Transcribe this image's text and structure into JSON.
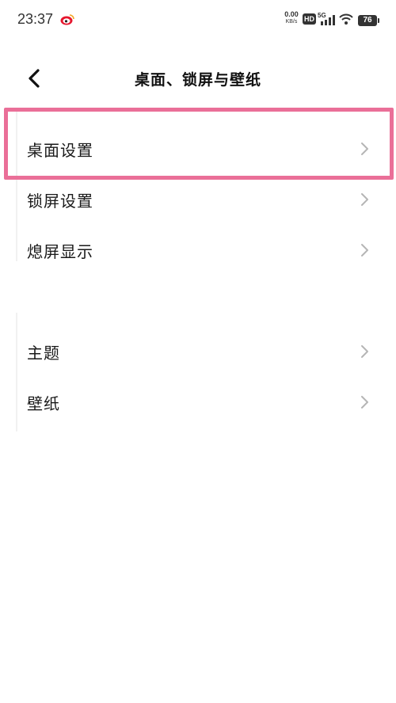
{
  "status_bar": {
    "time": "23:37",
    "net_speed_value": "0.00",
    "net_speed_unit": "KB/s",
    "hd_badge": "HD",
    "network_type": "5G",
    "battery_level": "76",
    "icons": [
      "weibo-icon",
      "signal-icon",
      "wifi-icon",
      "battery-icon"
    ]
  },
  "header": {
    "title": "桌面、锁屏与壁纸",
    "back_icon": "chevron-left-icon"
  },
  "sections": [
    {
      "items": [
        {
          "label": "桌面设置",
          "highlighted": true
        },
        {
          "label": "锁屏设置"
        },
        {
          "label": "熄屏显示"
        }
      ]
    },
    {
      "items": [
        {
          "label": "主题"
        },
        {
          "label": "壁纸"
        }
      ]
    }
  ],
  "colors": {
    "highlight": "#ea6f98",
    "chevron": "#b5b5b5",
    "text": "#1a1a1a"
  }
}
